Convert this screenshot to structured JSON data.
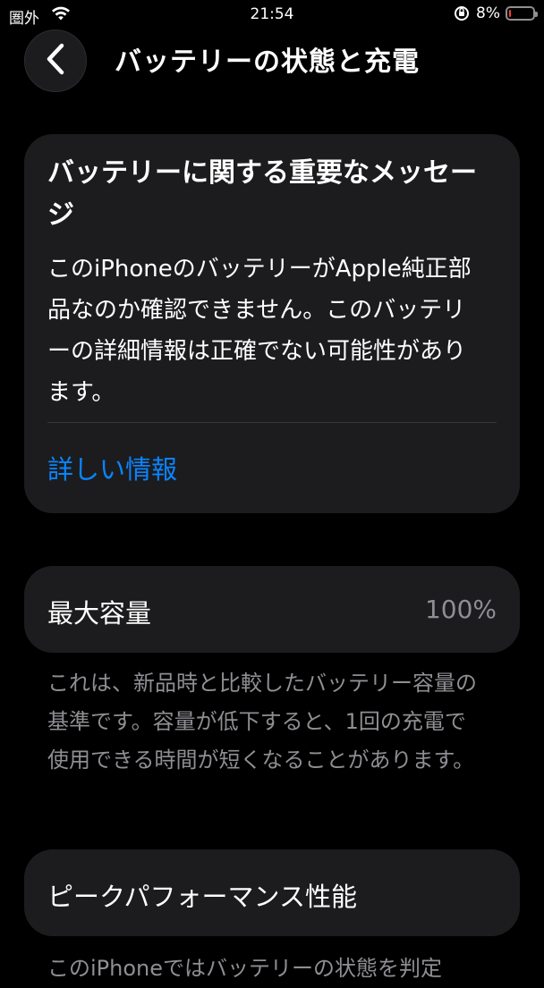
{
  "status_bar": {
    "carrier": "圏外",
    "time": "21:54",
    "battery_percent": "8%",
    "battery_level": 0.08,
    "battery_color": "#ff3b30"
  },
  "nav": {
    "back_icon": "chevron-left-icon",
    "title": "バッテリーの状態と充電"
  },
  "warning_card": {
    "title": "バッテリーに関する重要なメッセージ",
    "body": "このiPhoneのバッテリーがApple純正部品なのか確認できません。このバッテリーの詳細情報は正確でない可能性があります。",
    "link": "詳しい情報",
    "link_color": "#0a84ff"
  },
  "capacity": {
    "label": "最大容量",
    "value": "100%",
    "description": "これは、新品時と比較したバッテリー容量の基準です。容量が低下すると、1回の充電で使用できる時間が短くなることがあります。"
  },
  "peak": {
    "label": "ピークパフォーマンス性能",
    "description": "このiPhoneではバッテリーの状態を判定"
  }
}
